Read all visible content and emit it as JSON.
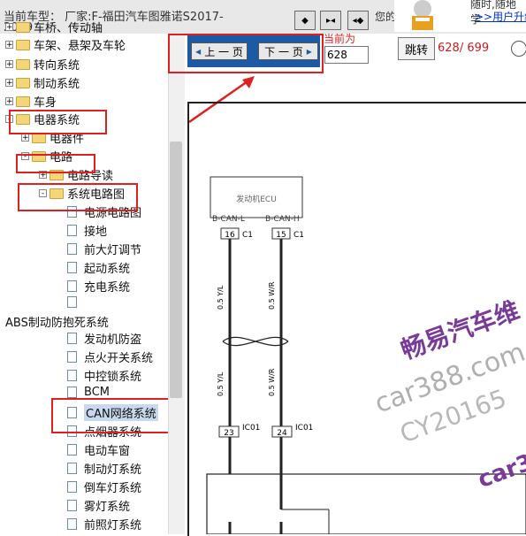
{
  "titlebar": {
    "line1": "当前车型： 厂家:F-福田汽车图雅诺S2017-",
    "line2": "2019",
    "prefix": "您的",
    "ad_top": "随时,随地学",
    "ad_link": ">>用户升级"
  },
  "tree": {
    "items": [
      {
        "label": "车桥、传动轴"
      },
      {
        "label": "车架、悬架及车轮"
      },
      {
        "label": "转向系统"
      },
      {
        "label": "制动系统"
      },
      {
        "label": "车身"
      },
      {
        "label": "电器系统"
      },
      {
        "label": "电器件"
      },
      {
        "label": "电路"
      },
      {
        "label": "电路导读"
      },
      {
        "label": "系统电路图"
      },
      {
        "label": "电源电路图"
      },
      {
        "label": "接地"
      },
      {
        "label": "前大灯调节"
      },
      {
        "label": "起动系统"
      },
      {
        "label": "充电系统"
      },
      {
        "label": ""
      },
      {
        "label": "ABS制动防抱死系统"
      },
      {
        "label": "发动机防盗"
      },
      {
        "label": "点火开关系统"
      },
      {
        "label": "中控锁系统"
      },
      {
        "label": "BCM"
      },
      {
        "label": "CAN网络系统"
      },
      {
        "label": "点烟器系统"
      },
      {
        "label": "电动车窗"
      },
      {
        "label": "制动灯系统"
      },
      {
        "label": "倒车灯系统"
      },
      {
        "label": "雾灯系统"
      },
      {
        "label": "前照灯系统"
      }
    ]
  },
  "pager": {
    "prev": "上 一 页",
    "next": "下 一 页",
    "current_label": "当前为",
    "page_value": "628",
    "jump": "跳转",
    "count": "628/ 699"
  },
  "diagram": {
    "ecu_label": "发动机ECU",
    "pin_left": "B-CAN-L",
    "pin_right": "B-CAN-H",
    "conn_left": "16",
    "conn_right": "15",
    "c_left": "C1",
    "c_right": "C1",
    "wire_left_top": "0.5 Y/L",
    "wire_right_top": "0.5 W/R",
    "wire_left_bot": "0.5 Y/L",
    "wire_right_bot": "0.5 W/R",
    "conn_left2": "23",
    "conn_right2": "24",
    "ic_left": "IC01",
    "ic_right": "IC01"
  },
  "watermark": {
    "cn": "畅易汽车维",
    "url": "car388.com",
    "cy": "CY20165",
    "car": "car3"
  },
  "colors": {
    "accent": "#1d5aa6",
    "highlight": "#e02020"
  }
}
